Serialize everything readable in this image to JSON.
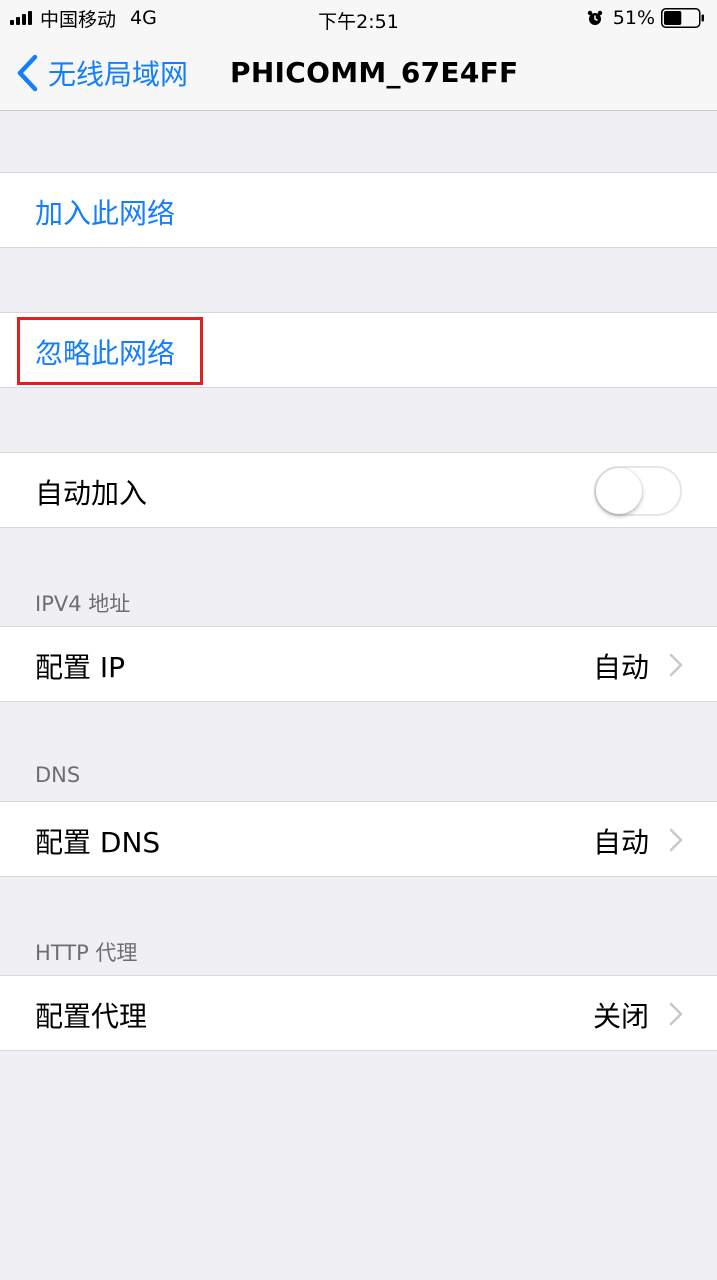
{
  "status_bar": {
    "carrier": "中国移动",
    "network": "4G",
    "time": "下午2:51",
    "battery_percent": "51%",
    "battery_level": 0.51
  },
  "nav": {
    "back_label": "无线局域网",
    "title": "PHICOMM_67E4FF"
  },
  "actions": {
    "join_label": "加入此网络",
    "forget_label": "忽略此网络"
  },
  "auto_join": {
    "label": "自动加入",
    "enabled": false
  },
  "ipv4": {
    "header": "IPV4 地址",
    "label": "配置 IP",
    "value": "自动"
  },
  "dns": {
    "header": "DNS",
    "label": "配置 DNS",
    "value": "自动"
  },
  "http_proxy": {
    "header": "HTTP 代理",
    "label": "配置代理",
    "value": "关闭"
  },
  "colors": {
    "accent": "#157efb",
    "highlight": "#e0211d",
    "background": "#efeff4"
  }
}
